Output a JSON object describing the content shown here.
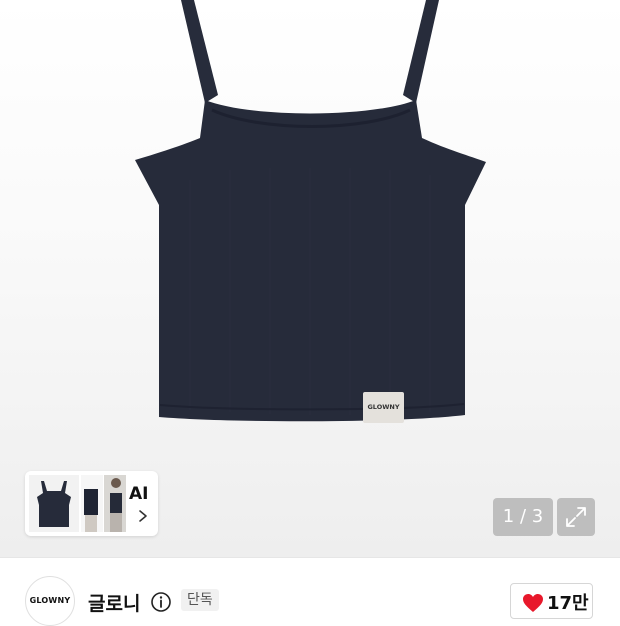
{
  "gallery": {
    "product_image": "navy-ribbed-crop-tank-top",
    "label_text": "GLOWNY",
    "ai_thumbnail": {
      "label": "AI",
      "icon": "chevron-right-icon"
    },
    "counter": "1 / 3",
    "expand_icon": "expand-icon"
  },
  "brand": {
    "logo_text": "GLOWNY",
    "name": "글로니",
    "info_icon": "info-icon",
    "badge": "단독"
  },
  "like": {
    "icon": "heart-icon",
    "count": "17만",
    "color": "#e8182b"
  },
  "colors": {
    "product_navy": "#262b3a"
  }
}
